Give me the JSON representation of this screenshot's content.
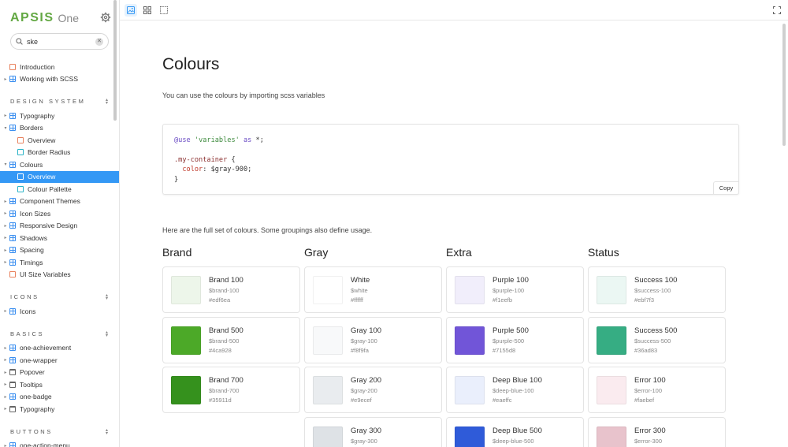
{
  "app": {
    "logo": "APSIS",
    "logo_sub": "One"
  },
  "search": {
    "value": "ske"
  },
  "sidebar": {
    "top_items": [
      {
        "label": "Introduction",
        "type": "doc",
        "caret": ""
      },
      {
        "label": "Working with SCSS",
        "type": "comp",
        "caret": "▸"
      }
    ],
    "sections": [
      {
        "title": "DESIGN SYSTEM",
        "items": [
          {
            "label": "Typography",
            "type": "comp",
            "level": 0,
            "caret": "▸"
          },
          {
            "label": "Borders",
            "type": "comp",
            "level": 0,
            "caret": "▾"
          },
          {
            "label": "Overview",
            "type": "doc",
            "level": 1,
            "caret": ""
          },
          {
            "label": "Border Radius",
            "type": "story",
            "level": 1,
            "caret": ""
          },
          {
            "label": "Colours",
            "type": "comp",
            "level": 0,
            "caret": "▾"
          },
          {
            "label": "Overview",
            "type": "doc",
            "level": 1,
            "caret": "",
            "selected": true
          },
          {
            "label": "Colour Pallette",
            "type": "story",
            "level": 1,
            "caret": ""
          },
          {
            "label": "Component Themes",
            "type": "comp",
            "level": 0,
            "caret": "▸"
          },
          {
            "label": "Icon Sizes",
            "type": "comp",
            "level": 0,
            "caret": "▸"
          },
          {
            "label": "Responsive Design",
            "type": "comp",
            "level": 0,
            "caret": "▸"
          },
          {
            "label": "Shadows",
            "type": "comp",
            "level": 0,
            "caret": "▸"
          },
          {
            "label": "Spacing",
            "type": "comp",
            "level": 0,
            "caret": "▸"
          },
          {
            "label": "Timings",
            "type": "comp",
            "level": 0,
            "caret": "▸"
          },
          {
            "label": "UI Size Variables",
            "type": "doc",
            "level": 0,
            "caret": ""
          }
        ]
      },
      {
        "title": "ICONS",
        "items": [
          {
            "label": "Icons",
            "type": "comp",
            "level": 0,
            "caret": "▸"
          }
        ]
      },
      {
        "title": "BASICS",
        "items": [
          {
            "label": "one-achievement",
            "type": "comp",
            "level": 0,
            "caret": "▸"
          },
          {
            "label": "one-wrapper",
            "type": "comp",
            "level": 0,
            "caret": "▸"
          },
          {
            "label": "Popover",
            "type": "folder",
            "level": 0,
            "caret": "▸"
          },
          {
            "label": "Tooltips",
            "type": "folder",
            "level": 0,
            "caret": "▸"
          },
          {
            "label": "one-badge",
            "type": "comp",
            "level": 0,
            "caret": "▸"
          },
          {
            "label": "Typography",
            "type": "folder",
            "level": 0,
            "caret": "▸"
          }
        ]
      },
      {
        "title": "BUTTONS",
        "items": [
          {
            "label": "one-action-menu",
            "type": "comp",
            "level": 0,
            "caret": "▸"
          },
          {
            "label": "one-button",
            "type": "comp",
            "level": 0,
            "caret": "▸"
          }
        ]
      }
    ]
  },
  "main": {
    "title": "Colours",
    "intro": "You can use the colours by importing scss variables",
    "code": {
      "line1_kw": "@use",
      "line1_str": "'variables'",
      "line1_as": "as",
      "line1_rest": "*;",
      "line3_sel": ".my-container",
      "line3_rest": " {",
      "line4_prop": "color",
      "line4_rest": ": $gray-900;",
      "line5": "}",
      "copy_label": "Copy"
    },
    "set_text": "Here are the full set of colours. Some groupings also define usage.",
    "groups": [
      {
        "title": "Brand",
        "swatches": [
          {
            "name": "Brand 100",
            "var": "$brand-100",
            "hex": "#edf6ea"
          },
          {
            "name": "Brand 500",
            "var": "$brand-500",
            "hex": "#4ca928"
          },
          {
            "name": "Brand 700",
            "var": "$brand-700",
            "hex": "#35911d"
          }
        ]
      },
      {
        "title": "Gray",
        "swatches": [
          {
            "name": "White",
            "var": "$white",
            "hex": "#ffffff"
          },
          {
            "name": "Gray 100",
            "var": "$gray-100",
            "hex": "#f8f9fa"
          },
          {
            "name": "Gray 200",
            "var": "$gray-200",
            "hex": "#e9ecef"
          },
          {
            "name": "Gray 300",
            "var": "$gray-300",
            "hex": "#dee2e6"
          }
        ]
      },
      {
        "title": "Extra",
        "swatches": [
          {
            "name": "Purple 100",
            "var": "$purple-100",
            "hex": "#f1eefb"
          },
          {
            "name": "Purple 500",
            "var": "$purple-500",
            "hex": "#7155d8"
          },
          {
            "name": "Deep Blue 100",
            "var": "$deep-blue-100",
            "hex": "#eaeffc"
          },
          {
            "name": "Deep Blue 500",
            "var": "$deep-blue-500",
            "hex": "#2f5bd9"
          }
        ]
      },
      {
        "title": "Status",
        "swatches": [
          {
            "name": "Success 100",
            "var": "$success-100",
            "hex": "#ebf7f3"
          },
          {
            "name": "Success 500",
            "var": "$success-500",
            "hex": "#36ad83"
          },
          {
            "name": "Error 100",
            "var": "$error-100",
            "hex": "#faebef"
          },
          {
            "name": "Error 300",
            "var": "$error-300",
            "hex": "#e8c3cc"
          }
        ]
      }
    ]
  },
  "icons": {
    "settings": "gear-icon",
    "search": "search-icon",
    "clear": "close-icon",
    "toolbar": [
      "image-icon",
      "grid-icon",
      "outline-icon"
    ],
    "fullscreen": "fullscreen-icon"
  },
  "colors": {
    "brand": "#63a843",
    "accent": "#3498f5"
  }
}
